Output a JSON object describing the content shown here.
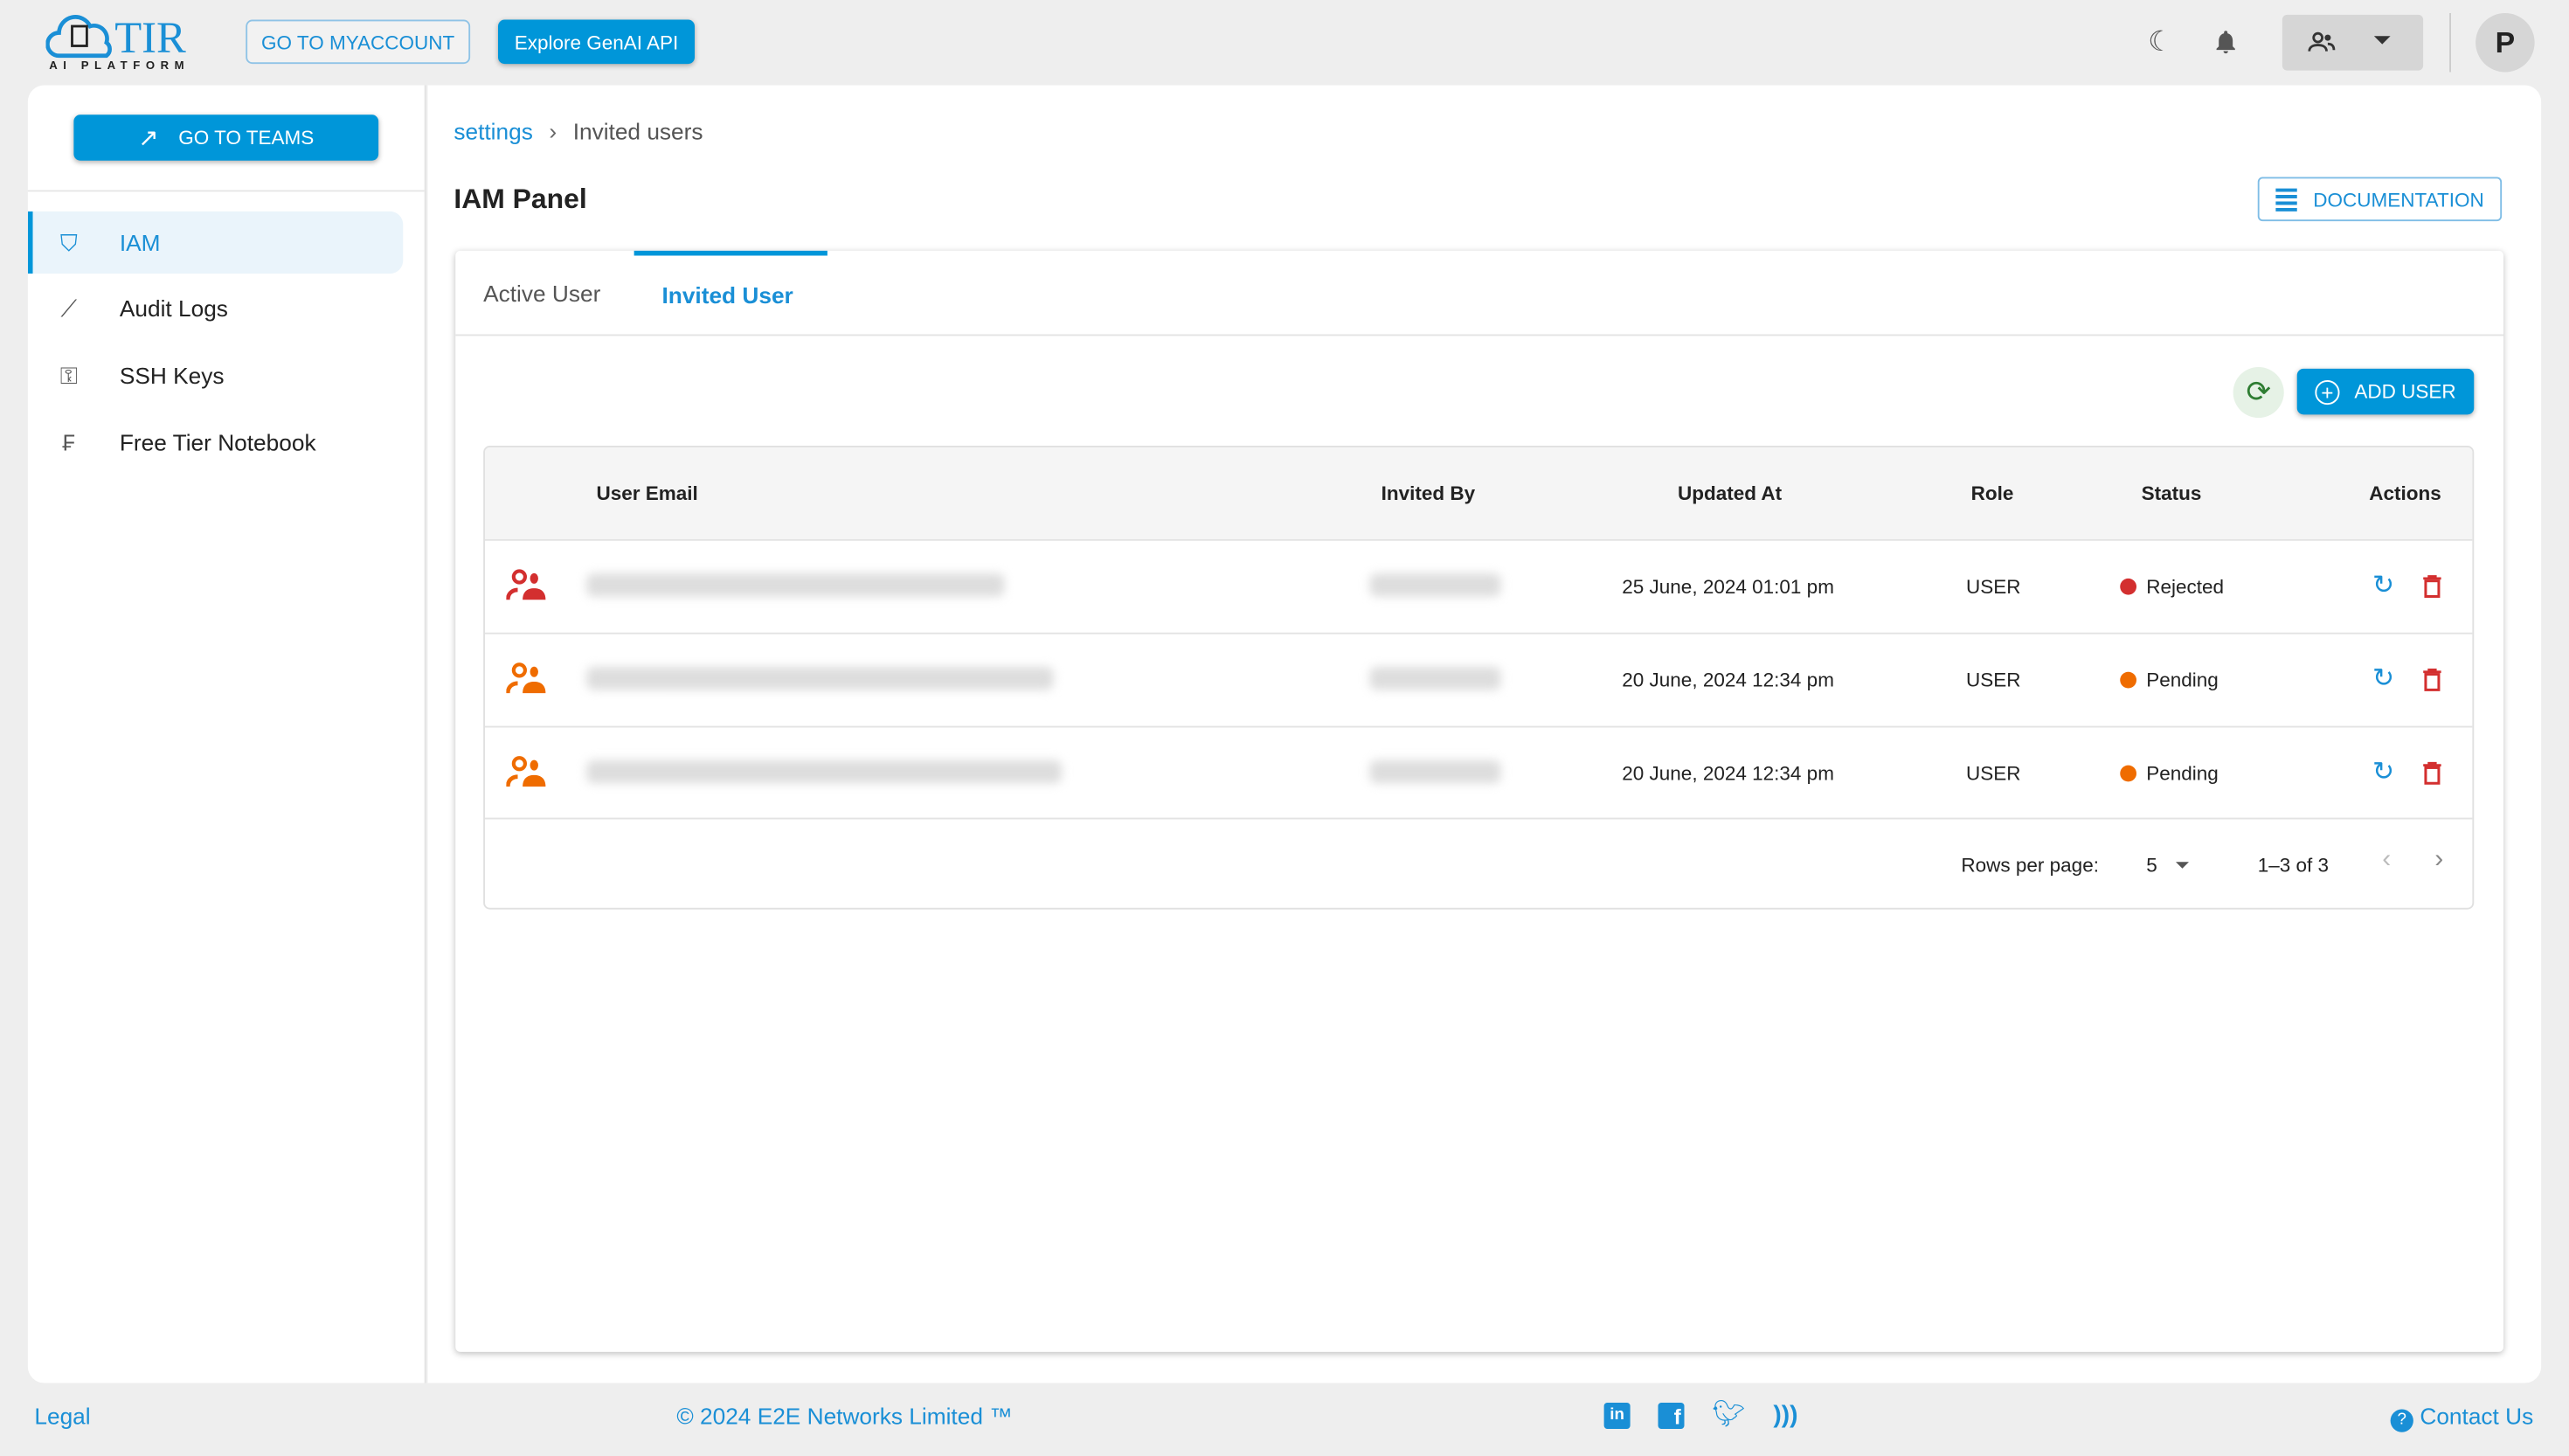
{
  "header": {
    "logo_text": "TIR",
    "logo_sub": "AI PLATFORM",
    "myaccount": "GO TO MYACCOUNT",
    "genai": "Explore GenAI API",
    "avatar": "P"
  },
  "sidebar": {
    "go_to_teams": "GO TO TEAMS",
    "items": [
      {
        "label": "IAM",
        "icon": "shield-icon",
        "active": true
      },
      {
        "label": "Audit Logs",
        "icon": "chart-search-icon"
      },
      {
        "label": "SSH Keys",
        "icon": "key-icon"
      },
      {
        "label": "Free Tier Notebook",
        "icon": "notebook-icon"
      }
    ]
  },
  "breadcrumb": {
    "parent": "settings",
    "separator": "›",
    "current": "Invited users"
  },
  "page": {
    "title": "IAM Panel",
    "documentation": "DOCUMENTATION"
  },
  "tabs": [
    {
      "label": "Active User"
    },
    {
      "label": "Invited User",
      "active": true
    }
  ],
  "toolbar": {
    "add_user": "ADD USER"
  },
  "table": {
    "headers": [
      "User Email",
      "Invited By",
      "Updated At",
      "Role",
      "Status",
      "Actions"
    ],
    "rows": [
      {
        "updated_at": "25 June, 2024 01:01 pm",
        "role": "USER",
        "status": "Rejected",
        "status_color": "#d32f2f"
      },
      {
        "updated_at": "20 June, 2024 12:34 pm",
        "role": "USER",
        "status": "Pending",
        "status_color": "#ef6c00"
      },
      {
        "updated_at": "20 June, 2024 12:34 pm",
        "role": "USER",
        "status": "Pending",
        "status_color": "#ef6c00"
      }
    ]
  },
  "pagination": {
    "rows_per_page_label": "Rows per page:",
    "rows_per_page": "5",
    "range": "1–3 of 3"
  },
  "footer": {
    "legal": "Legal",
    "copyright": "© 2024 E2E Networks Limited ™",
    "contact": "Contact Us"
  },
  "colors": {
    "accent": "#0096d9",
    "rejected": "#d32f2f",
    "pending": "#ef6c00"
  }
}
